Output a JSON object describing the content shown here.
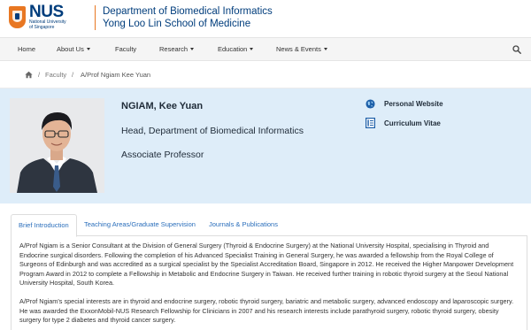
{
  "header": {
    "university": "NUS",
    "university_full_line1": "National University",
    "university_full_line2": "of Singapore",
    "department": "Department of Biomedical Informatics",
    "school": "Yong Loo Lin School of Medicine"
  },
  "nav": {
    "items": [
      {
        "label": "Home",
        "dropdown": false
      },
      {
        "label": "About Us",
        "dropdown": true
      },
      {
        "label": "Faculty",
        "dropdown": false
      },
      {
        "label": "Research",
        "dropdown": true
      },
      {
        "label": "Education",
        "dropdown": true
      },
      {
        "label": "News & Events",
        "dropdown": true
      }
    ]
  },
  "breadcrumb": {
    "sep": "/",
    "items": [
      "Faculty",
      "A/Prof Ngiam Kee Yuan"
    ]
  },
  "profile": {
    "name": "NGIAM, Kee Yuan",
    "position": "Head, Department of Biomedical Informatics",
    "title": "Associate Professor",
    "links": [
      {
        "label": "Personal Website",
        "icon": "globe-icon"
      },
      {
        "label": "Curriculum Vitae",
        "icon": "document-icon"
      }
    ]
  },
  "tabs": [
    "Brief Introduction",
    "Teaching Areas/Graduate Supervision",
    "Journals & Publications"
  ],
  "active_tab": "Brief Introduction",
  "content": {
    "paragraphs": [
      "A/Prof Ngiam is a Senior Consultant at the Division of General Surgery (Thyroid & Endocrine Surgery) at the National University Hospital, specialising in Thyroid and Endocrine surgical disorders. Following the completion of his Advanced Specialist Training in General Surgery, he was awarded a fellowship from the Royal College of Surgeons of Edinburgh and was accredited as a surgical specialist by the Specialist Accreditation Board, Singapore in 2012. He received the Higher Manpower Development Program Award in 2012 to complete a Fellowship in Metabolic and Endocrine Surgery in Taiwan. He received further training in robotic thyroid surgery at the Seoul National University Hospital, South Korea.",
      "A/Prof Ngiam's special interests are in thyroid and endocrine surgery, robotic thyroid surgery, bariatric and metabolic surgery, advanced endoscopy and laparoscopic surgery. He was awarded the ExxonMobil-NUS Research Fellowship for Clinicians in 2007 and his research interests include parathyroid surgery, robotic thyroid surgery, obesity surgery for type 2 diabetes and thyroid cancer surgery."
    ]
  },
  "colors": {
    "nus_blue": "#003d7c",
    "nus_orange": "#e87722",
    "profile_bg": "#deedf9",
    "link_blue": "#2a6ebb"
  }
}
